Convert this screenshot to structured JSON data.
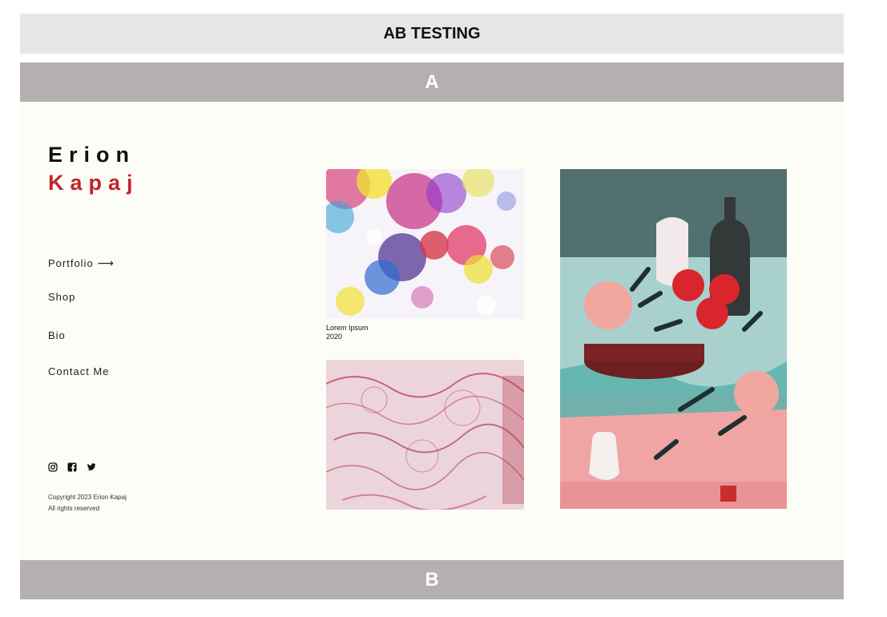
{
  "header": {
    "title": "AB TESTING"
  },
  "variants": {
    "a_label": "A",
    "b_label": "B"
  },
  "site": {
    "first_name": "Erion",
    "last_name": "Kapaj",
    "accent_color": "#c0262b",
    "nav": [
      {
        "label": "Portfolio",
        "icon": "arrow-right-icon"
      },
      {
        "label": "Shop"
      },
      {
        "label": "Bio"
      },
      {
        "label": "Contact Me"
      }
    ],
    "social": [
      "instagram-icon",
      "facebook-icon",
      "twitter-icon"
    ],
    "copyright_line1": "Copyright 2023 Erion Kapaj",
    "copyright_line2": "All rights reserved"
  },
  "gallery": {
    "caption_title": "Lorem Ipsum",
    "caption_year": "2020"
  }
}
